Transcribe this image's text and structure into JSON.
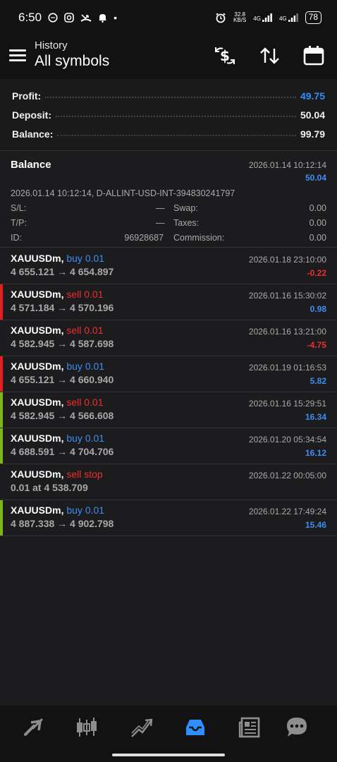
{
  "status_bar": {
    "time": "6:50",
    "net_speed_top": "32.8",
    "net_speed_bottom": "KB/S",
    "net1": "4G",
    "net2": "4G",
    "battery": "78",
    "icons": [
      "whatsapp-icon",
      "instagram-icon",
      "missed-call-icon",
      "notification-bell-icon",
      "alarm-icon",
      "vibrate-icon",
      "signal-icon",
      "battery-icon"
    ]
  },
  "app_bar": {
    "subtitle": "History",
    "title": "All symbols",
    "actions": [
      "currency-exchange-icon",
      "sort-icon",
      "calendar-icon"
    ]
  },
  "summary": [
    {
      "label": "Profit:",
      "value": "49.75",
      "color": "#2f8fff"
    },
    {
      "label": "Deposit:",
      "value": "50.04",
      "color": "#f0f0f0"
    },
    {
      "label": "Balance:",
      "value": "99.79",
      "color": "#f0f0f0"
    }
  ],
  "balance_entry": {
    "title": "Balance",
    "date": "2026.01.14 10:12:14",
    "amount": "50.04",
    "description": "2026.01.14 10:12:14, D-ALLINT-USD-INT-394830241797",
    "sl_label": "S/L:",
    "sl_value": "—",
    "tp_label": "T/P:",
    "tp_value": "—",
    "id_label": "ID:",
    "id_value": "96928687",
    "swap_label": "Swap:",
    "swap_value": "0.00",
    "taxes_label": "Taxes:",
    "taxes_value": "0.00",
    "commission_label": "Commission:",
    "commission_value": "0.00"
  },
  "trades": [
    {
      "symbol": "XAUUSDm,",
      "side": "buy 0.01",
      "side_type": "buy",
      "prices": "4 655.121 → 4 654.897",
      "date": "2026.01.18 23:10:00",
      "profit": "-0.22",
      "profit_sign": "neg",
      "bar": ""
    },
    {
      "symbol": "XAUUSDm,",
      "side": "sell 0.01",
      "side_type": "sell",
      "prices": "4 571.184 → 4 570.196",
      "date": "2026.01.16 15:30:02",
      "profit": "0.98",
      "profit_sign": "pos",
      "bar": "#e02020"
    },
    {
      "symbol": "XAUUSDm,",
      "side": "sell 0.01",
      "side_type": "sell",
      "prices": "4 582.945 → 4 587.698",
      "date": "2026.01.16 13:21:00",
      "profit": "-4.75",
      "profit_sign": "neg",
      "bar": ""
    },
    {
      "symbol": "XAUUSDm,",
      "side": "buy 0.01",
      "side_type": "buy",
      "prices": "4 655.121 → 4 660.940",
      "date": "2026.01.19 01:16:53",
      "profit": "5.82",
      "profit_sign": "pos",
      "bar": "#e02020"
    },
    {
      "symbol": "XAUUSDm,",
      "side": "sell 0.01",
      "side_type": "sell",
      "prices": "4 582.945 → 4 566.608",
      "date": "2026.01.16 15:29:51",
      "profit": "16.34",
      "profit_sign": "pos",
      "bar": "#7cb518"
    },
    {
      "symbol": "XAUUSDm,",
      "side": "buy 0.01",
      "side_type": "buy",
      "prices": "4 688.591 → 4 704.706",
      "date": "2026.01.20 05:34:54",
      "profit": "16.12",
      "profit_sign": "pos",
      "bar": "#7cb518"
    },
    {
      "symbol": "XAUUSDm,",
      "side": "sell stop",
      "side_type": "sell",
      "prices": "0.01 at 4 538.709",
      "date": "2026.01.22 00:05:00",
      "profit": "",
      "profit_sign": "pos",
      "bar": ""
    },
    {
      "symbol": "XAUUSDm,",
      "side": "buy 0.01",
      "side_type": "buy",
      "prices": "4 887.338 → 4 902.798",
      "date": "2026.01.22 17:49:24",
      "profit": "15.46",
      "profit_sign": "pos",
      "bar": "#7cb518"
    }
  ],
  "bottom_nav": [
    {
      "name": "quotes-icon",
      "active": false
    },
    {
      "name": "chart-icon",
      "active": false
    },
    {
      "name": "trade-icon",
      "active": false
    },
    {
      "name": "history-icon",
      "active": true
    },
    {
      "name": "news-icon",
      "active": false
    },
    {
      "name": "messages-icon",
      "active": false
    }
  ]
}
